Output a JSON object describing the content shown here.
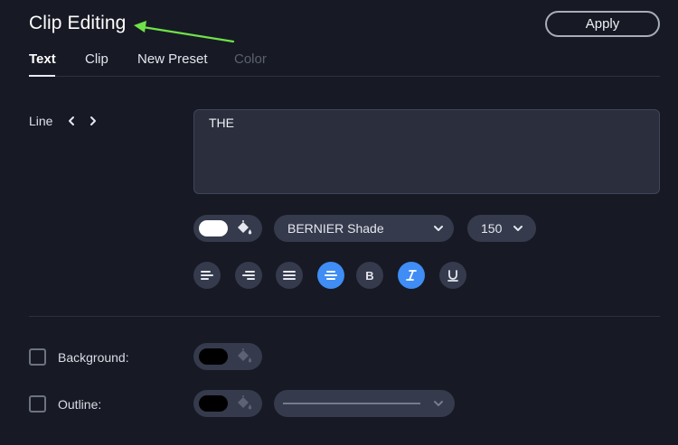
{
  "header": {
    "title": "Clip Editing",
    "apply_label": "Apply"
  },
  "tabs": [
    {
      "label": "Text",
      "state": "active"
    },
    {
      "label": "Clip",
      "state": "normal"
    },
    {
      "label": "New Preset",
      "state": "normal"
    },
    {
      "label": "Color",
      "state": "disabled"
    }
  ],
  "line": {
    "label": "Line",
    "prev_icon": "chevron-left-icon",
    "next_icon": "chevron-right-icon",
    "text_value": "THE"
  },
  "text_style": {
    "fill_color": "#ffffff",
    "font_family": "BERNIER Shade",
    "font_size": "150",
    "formatting": [
      {
        "name": "align-left-icon",
        "active": false
      },
      {
        "name": "align-right-icon",
        "active": false
      },
      {
        "name": "align-justify-icon",
        "active": false
      },
      {
        "name": "align-center-icon",
        "active": true
      },
      {
        "name": "bold-icon",
        "active": false
      },
      {
        "name": "italic-icon",
        "active": true
      },
      {
        "name": "underline-icon",
        "active": false
      }
    ]
  },
  "background": {
    "label": "Background:",
    "checked": false,
    "color": "#000000"
  },
  "outline": {
    "label": "Outline:",
    "checked": false,
    "color": "#000000"
  },
  "colors": {
    "bg": "#171a24",
    "accent": "#3f8df5",
    "pill": "#353a4c",
    "annotation_arrow": "#6fe24a"
  }
}
